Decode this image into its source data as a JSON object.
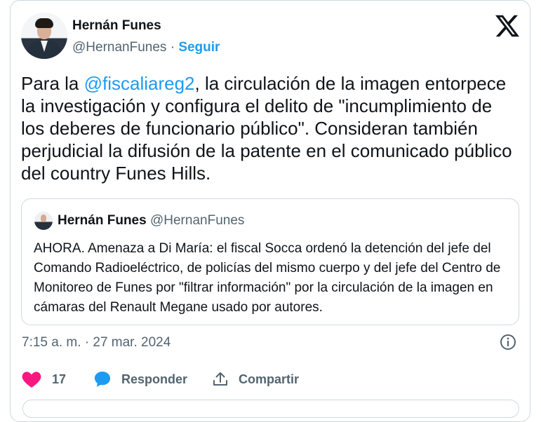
{
  "author": {
    "name": "Hernán Funes",
    "handle": "@HernanFunes",
    "separator": "·",
    "follow_label": "Seguir"
  },
  "tweet": {
    "text_prefix": "Para la ",
    "mention": "@fiscaliareg2",
    "text_rest": ", la circulación de la imagen entorpece la investigación y configura el delito de \"incumplimiento de los deberes de funcionario público\". Consideran también perjudicial la difusión de la patente en el comunicado público del country Funes Hills.",
    "timestamp": "7:15 a. m. · 27 mar. 2024"
  },
  "quote": {
    "name": "Hernán Funes",
    "handle": "@HernanFunes",
    "text": "AHORA. Amenaza a Di María: el fiscal Socca ordenó la detención del jefe del Comando Radioeléctrico, de policías del mismo cuerpo y del jefe del Centro de Monitoreo de Funes por \"filtrar información\" por la circulación de la imagen en cámaras del Renault Megane usado por autores."
  },
  "actions": {
    "like_count": "17",
    "reply_label": "Responder",
    "share_label": "Compartir"
  },
  "icons": [
    "x-logo-icon",
    "info-icon",
    "heart-icon",
    "reply-bubble-icon",
    "share-icon"
  ],
  "colors": {
    "accent": "#1d9bf0",
    "like": "#f91880",
    "muted": "#536471"
  }
}
